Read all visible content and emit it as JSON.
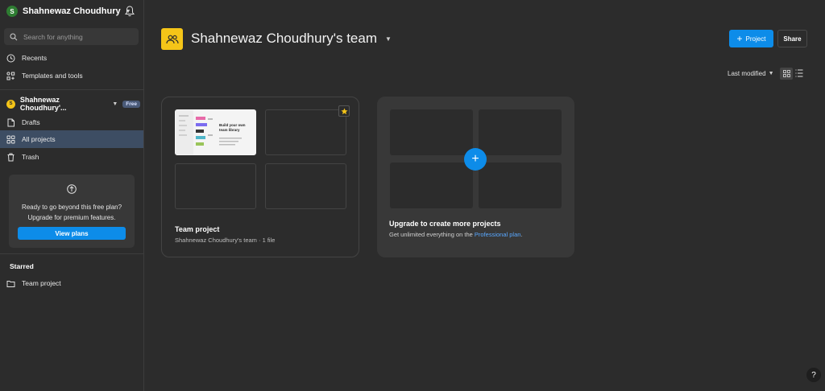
{
  "account": {
    "name": "Shahnewaz Choudhury",
    "initial": "S"
  },
  "search": {
    "placeholder": "Search for anything"
  },
  "nav": {
    "recents": "Recents",
    "templates": "Templates and tools",
    "team_name": "Shahnewaz Choudhury'...",
    "team_initial": "S",
    "free_badge": "Free",
    "drafts": "Drafts",
    "all_projects": "All projects",
    "trash": "Trash"
  },
  "upgrade_card": {
    "line1": "Ready to go beyond this free plan?",
    "line2": "Upgrade for premium features.",
    "button": "View plans"
  },
  "starred": {
    "label": "Starred",
    "items": [
      "Team project"
    ]
  },
  "header": {
    "title": "Shahnewaz Choudhury's team",
    "project_button": "Project",
    "share_button": "Share",
    "sort_label": "Last modified"
  },
  "project_card": {
    "title": "Team project",
    "subtitle": "Shahnewaz Choudhury's team · 1 file",
    "thumbnail_heading": "Build your own team library"
  },
  "upgrade_panel": {
    "title": "Upgrade to create more projects",
    "subtitle_prefix": "Get unlimited everything on the ",
    "link": "Professional plan",
    "suffix": "."
  },
  "help": "?",
  "colors": {
    "accent": "#0d8ce9",
    "team": "#f5c518",
    "active_nav": "#3d4d63"
  }
}
